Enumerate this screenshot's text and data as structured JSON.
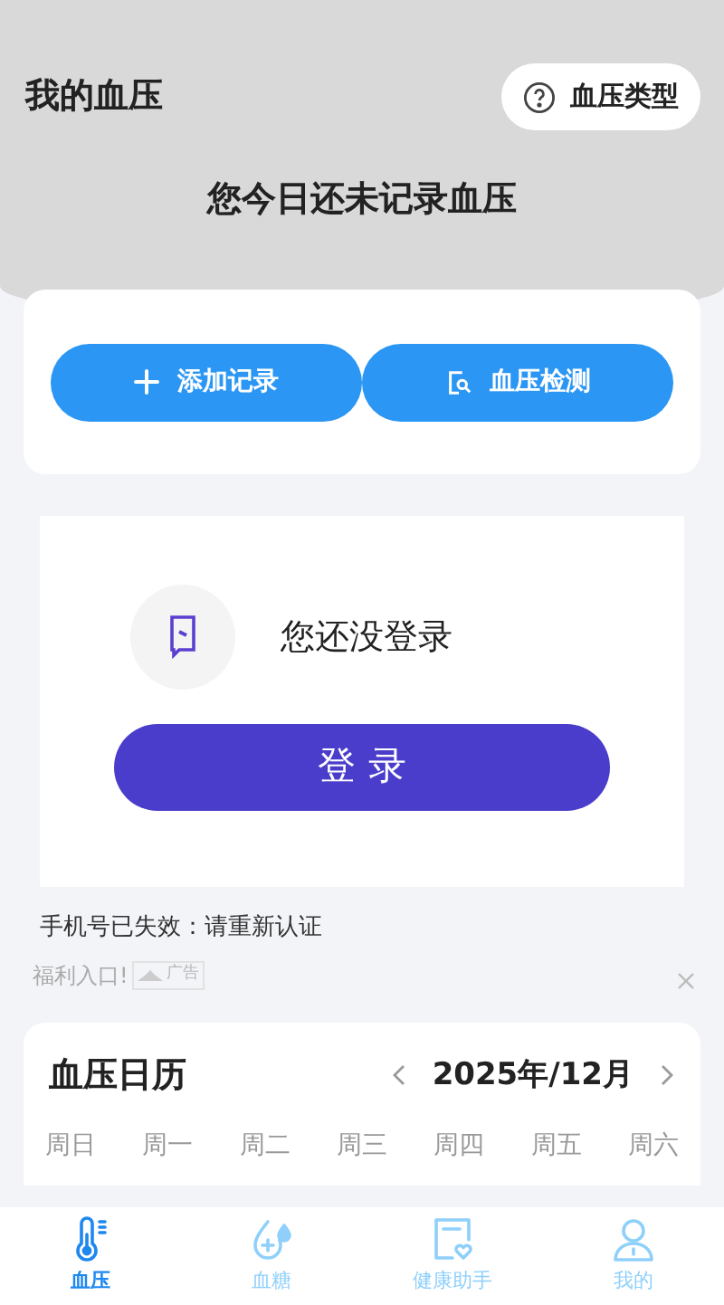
{
  "header": {
    "title": "我的血压",
    "type_button": "血压类型",
    "today_message": "您今日还未记录血压"
  },
  "actions": [
    {
      "label": "添加记录",
      "kind": "plus"
    },
    {
      "label": "血压检测",
      "kind": "scan"
    }
  ],
  "login": {
    "message": "您还没登录",
    "button": "登 录"
  },
  "notice": "手机号已失效：请重新认证",
  "ad": {
    "label": "福利入口!",
    "tag": "广告"
  },
  "calendar": {
    "title": "血压日历",
    "month": "2025年/12月",
    "weekdays": [
      "周日",
      "周一",
      "周二",
      "周三",
      "周四",
      "周五",
      "周六"
    ]
  },
  "tabs": [
    {
      "label": "血压",
      "kind": "thermometer",
      "selected": true
    },
    {
      "label": "血糖",
      "kind": "drop",
      "selected": false
    },
    {
      "label": "健康助手",
      "kind": "heart-card",
      "selected": false
    },
    {
      "label": "我的",
      "kind": "person",
      "selected": false
    }
  ]
}
